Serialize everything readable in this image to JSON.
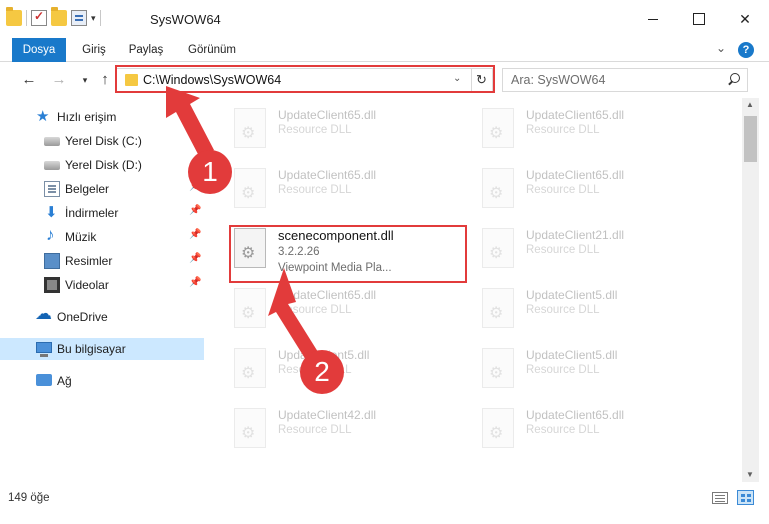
{
  "window": {
    "title": "SysWOW64",
    "minimize_label": "",
    "maximize_label": "",
    "close_label": "✕"
  },
  "ribbon": {
    "tabs": [
      {
        "label": "Dosya"
      },
      {
        "label": "Giriş"
      },
      {
        "label": "Paylaş"
      },
      {
        "label": "Görünüm"
      }
    ],
    "help": "?",
    "expand": "⌄"
  },
  "navigation": {
    "address": "C:\\Windows\\SysWOW64",
    "search_placeholder": "Ara: SysWOW64"
  },
  "sidebar": {
    "items": [
      {
        "label": "Hızlı erişim",
        "icon": "star-icon"
      },
      {
        "label": "Yerel Disk (C:)",
        "icon": "disk-icon"
      },
      {
        "label": "Yerel Disk (D:)",
        "icon": "disk-icon"
      },
      {
        "label": "Belgeler",
        "icon": "documents-icon"
      },
      {
        "label": "İndirmeler",
        "icon": "download-icon"
      },
      {
        "label": "Müzik",
        "icon": "music-icon"
      },
      {
        "label": "Resimler",
        "icon": "pictures-icon"
      },
      {
        "label": "Videolar",
        "icon": "video-icon"
      },
      {
        "label": "OneDrive",
        "icon": "cloud-icon"
      },
      {
        "label": "Bu bilgisayar",
        "icon": "computer-icon"
      },
      {
        "label": "Ağ",
        "icon": "network-icon"
      }
    ]
  },
  "files": {
    "left_column": [
      {
        "name": "UpdateClient65.dll",
        "type": "Resource DLL"
      },
      {
        "name": "UpdateClient65.dll",
        "type": "Resource DLL"
      },
      {
        "name": "UpdateClient65.dll",
        "type": "Resource DLL"
      },
      {
        "name": "UpdateClient5.dll",
        "type": "Resource DLL"
      },
      {
        "name": "UpdateClient42.dll",
        "type": "Resource DLL"
      }
    ],
    "right_column": [
      {
        "name": "UpdateClient65.dll",
        "type": "Resource DLL"
      },
      {
        "name": "UpdateClient65.dll",
        "type": "Resource DLL"
      },
      {
        "name": "UpdateClient21.dll",
        "type": "Resource DLL"
      },
      {
        "name": "UpdateClient5.dll",
        "type": "Resource DLL"
      },
      {
        "name": "UpdateClient5.dll",
        "type": "Resource DLL"
      },
      {
        "name": "UpdateClient65.dll",
        "type": "Resource DLL"
      }
    ],
    "highlighted": {
      "name": "scenecomponent.dll",
      "version": "3.2.2.26",
      "description": "Viewpoint Media Pla..."
    }
  },
  "status": {
    "item_count": "149 öğe"
  },
  "annotations": {
    "step1": "1",
    "step2": "2",
    "color": "#e23b3b"
  }
}
